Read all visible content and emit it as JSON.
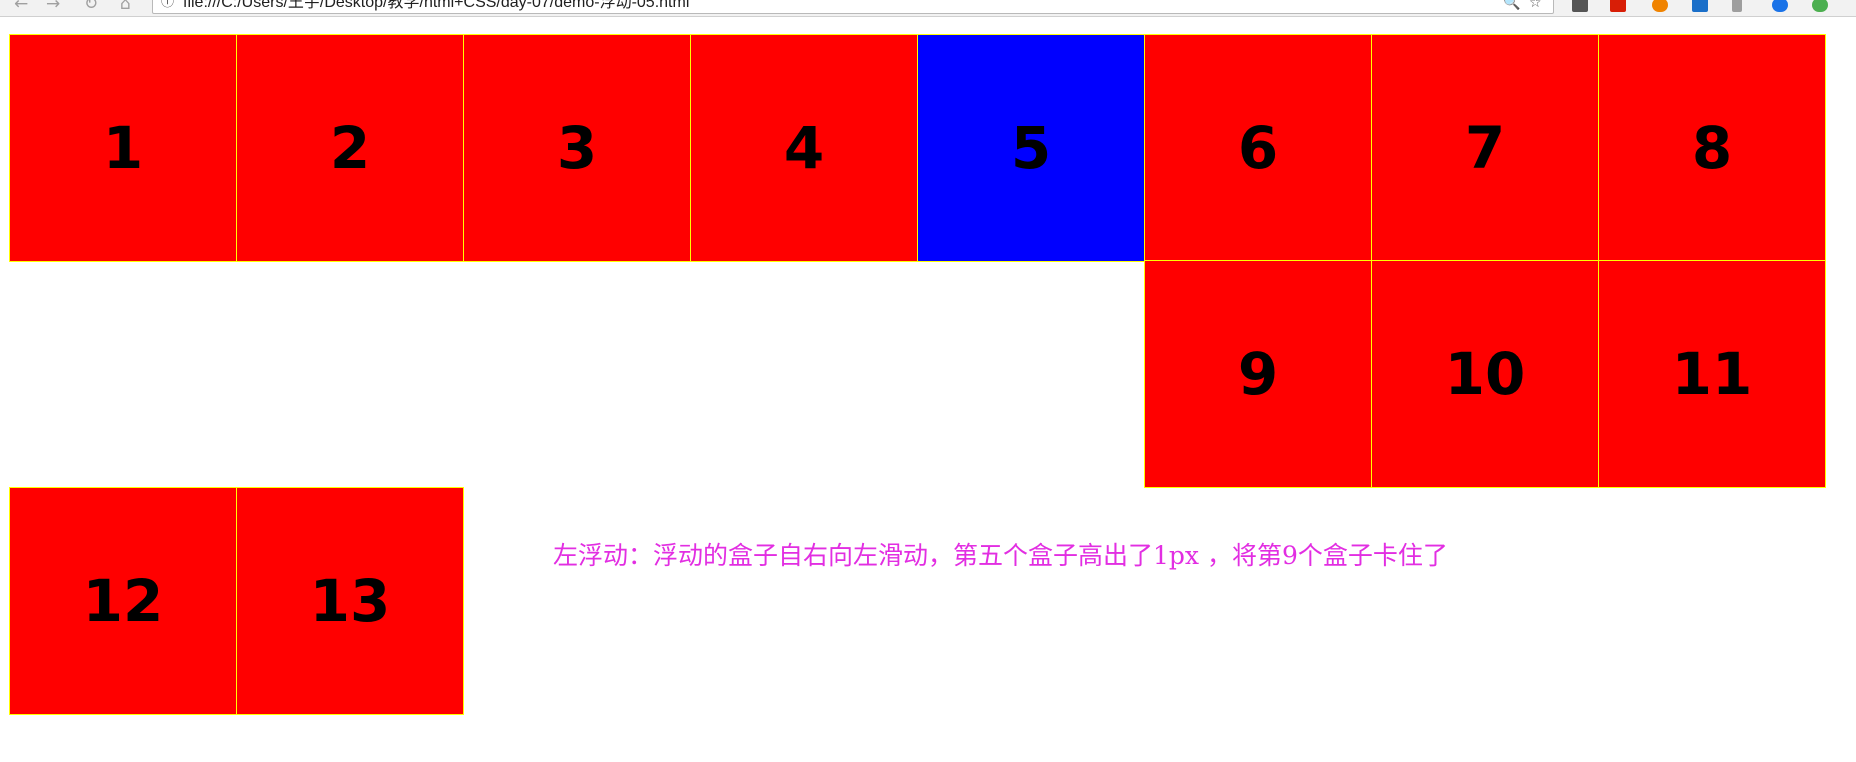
{
  "browser": {
    "url": "file:///C:/Users/王宇/Desktop/教学/html+CSS/day-07/demo-浮动-05.html",
    "nav": {
      "back_glyph": "←",
      "forward_glyph": "→",
      "reload_glyph": "↻",
      "home_glyph": "⌂",
      "info_glyph": "ⓘ",
      "zoom_glyph": "🔍",
      "star_glyph": "☆"
    },
    "extension_colors": [
      "#555555",
      "#d81e06",
      "#f08300",
      "#1a6fc9",
      "#9e9e9e",
      "#1a73e8",
      "#4caf50"
    ]
  },
  "boxes": {
    "b1": {
      "label": "1",
      "color": "#ff0000"
    },
    "b2": {
      "label": "2",
      "color": "#ff0000"
    },
    "b3": {
      "label": "3",
      "color": "#ff0000"
    },
    "b4": {
      "label": "4",
      "color": "#ff0000"
    },
    "b5": {
      "label": "5",
      "color": "#0000ff"
    },
    "b6": {
      "label": "6",
      "color": "#ff0000"
    },
    "b7": {
      "label": "7",
      "color": "#ff0000"
    },
    "b8": {
      "label": "8",
      "color": "#ff0000"
    },
    "b9": {
      "label": "9",
      "color": "#ff0000"
    },
    "b10": {
      "label": "10",
      "color": "#ff0000"
    },
    "b11": {
      "label": "11",
      "color": "#ff0000"
    },
    "b12": {
      "label": "12",
      "color": "#ff0000"
    },
    "b13": {
      "label": "13",
      "color": "#ff0000"
    }
  },
  "caption": {
    "text": "左浮动：浮动的盒子自右向左滑动，第五个盒子高出了1px ，将第9个盒子卡住了",
    "color": "#e22ee2"
  },
  "colors": {
    "box_border": "#ffff00",
    "box_red": "#ff0000",
    "box_blue": "#0000ff"
  }
}
